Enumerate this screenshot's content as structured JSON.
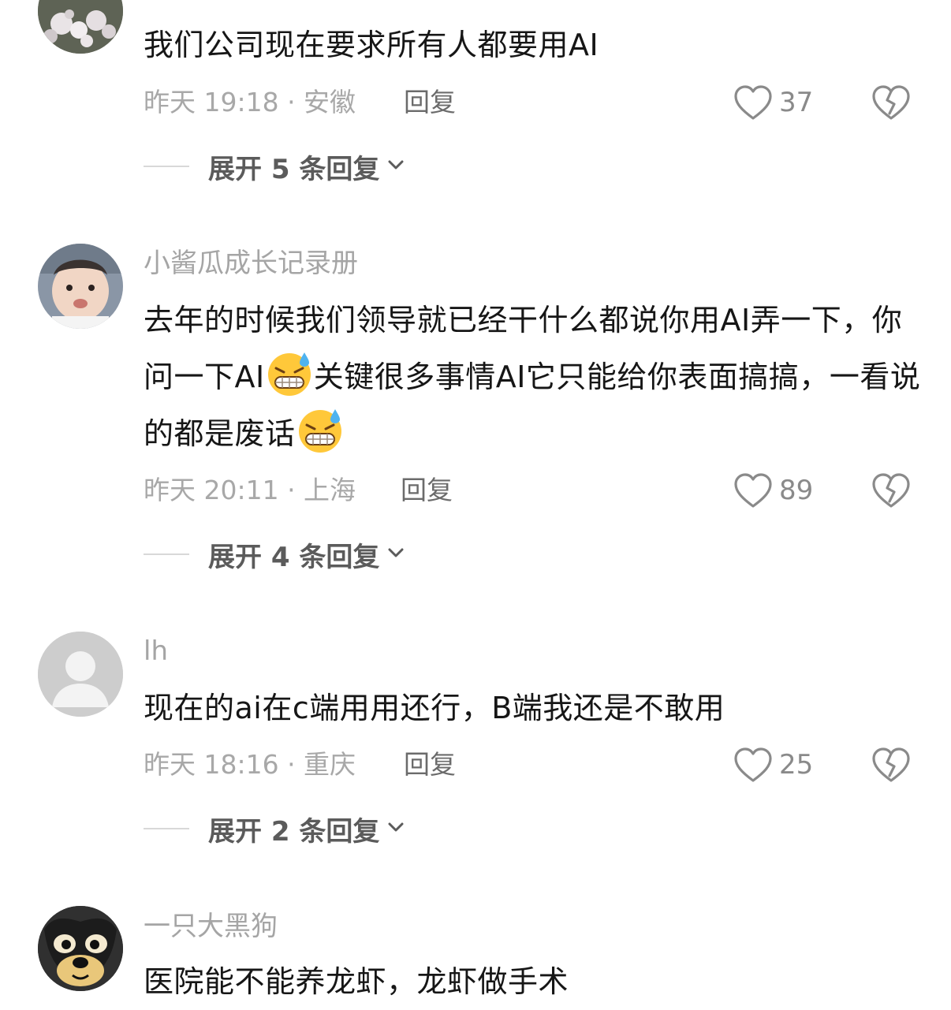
{
  "comments": [
    {
      "username": "",
      "text": "我们公司现在要求所有人都要用AI",
      "time_location": "昨天 19:18 · 安徽",
      "reply_label": "回复",
      "likes": "37",
      "expand_label": "展开 5 条回复"
    },
    {
      "username": "小酱瓜成长记录册",
      "text_parts": [
        "去年的时候我们领导就已经干什么都说你用AI弄一下，你问一下AI",
        "关键很多事情AI它只能给你表面搞搞，一看说的都是废话"
      ],
      "time_location": "昨天 20:11 · 上海",
      "reply_label": "回复",
      "likes": "89",
      "expand_label": "展开 4 条回复"
    },
    {
      "username": "lh",
      "text": "现在的ai在c端用用还行，B端我还是不敢用",
      "time_location": "昨天 18:16 · 重庆",
      "reply_label": "回复",
      "likes": "25",
      "expand_label": "展开 2 条回复"
    },
    {
      "username": "一只大黑狗",
      "text": "医院能不能养龙虾，龙虾做手术"
    }
  ],
  "icons": {
    "like": "heart-outline-icon",
    "dislike": "broken-heart-icon",
    "expand": "chevron-down-icon",
    "emoji": "grimacing-sweat-emoji"
  },
  "colors": {
    "text": "#161616",
    "meta": "#a8a8a8",
    "reply": "#6b6b6b",
    "expand": "#5b5b5b"
  }
}
